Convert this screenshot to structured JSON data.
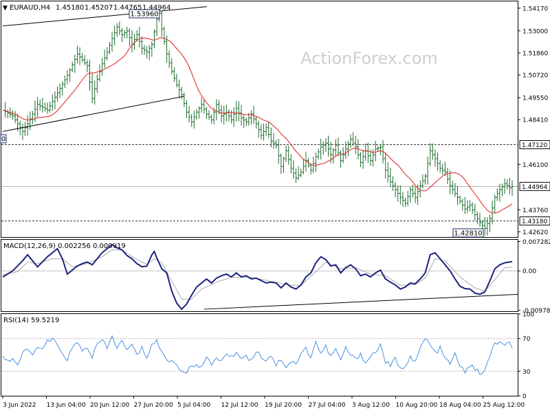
{
  "chart_data": [
    {
      "type": "candlestick",
      "title": "EURAUD,H4",
      "ohlc_label": {
        "open": "1.45180",
        "high": "1.45207",
        "low": "1.44765",
        "close": "1.44964"
      },
      "watermark": "ActionForex.com",
      "ylim": [
        1.4235,
        1.5452
      ],
      "y_ticks": [
        "1.54170",
        "1.53000",
        "1.51860",
        "1.50720",
        "1.49550",
        "1.48410",
        "1.47120",
        "1.46100",
        "1.44964",
        "1.43760",
        "1.43180",
        "1.42620"
      ],
      "x_ticks": [
        "3 Jun 2022",
        "13 Jun 04:00",
        "20 Jun 12:00",
        "27 Jun 20:00",
        "5 Jul 04:00",
        "12 Jul 12:00",
        "19 Jul 20:00",
        "27 Jul 04:00",
        "3 Aug 12:00",
        "10 Aug 20:00",
        "18 Aug 04:00",
        "25 Aug 12:00"
      ],
      "annotations": [
        "1.53960",
        "1.42810",
        "0"
      ],
      "horizontal_levels": [
        {
          "value": 1.4712,
          "label": "1.47120",
          "style": "dashed"
        },
        {
          "value": 1.4318,
          "label": "1.43180",
          "style": "dashed"
        },
        {
          "value": 1.44964,
          "label": "1.44964",
          "style": "solid-gray",
          "current_price": true
        }
      ],
      "moving_average_color": "#e03030",
      "price_color": "#1a6b2a",
      "close_path": [
        [
          0,
          1.489
        ],
        [
          4,
          1.486
        ],
        [
          8,
          1.478
        ],
        [
          10,
          1.482
        ],
        [
          14,
          1.492
        ],
        [
          18,
          1.489
        ],
        [
          22,
          1.498
        ],
        [
          26,
          1.507
        ],
        [
          30,
          1.518
        ],
        [
          34,
          1.512
        ],
        [
          36,
          1.495
        ],
        [
          38,
          1.505
        ],
        [
          40,
          1.513
        ],
        [
          42,
          1.519
        ],
        [
          44,
          1.526
        ],
        [
          46,
          1.532
        ],
        [
          48,
          1.528
        ],
        [
          50,
          1.53
        ],
        [
          52,
          1.523
        ],
        [
          54,
          1.528
        ],
        [
          56,
          1.521
        ],
        [
          58,
          1.519
        ],
        [
          60,
          1.523
        ],
        [
          62,
          1.536
        ],
        [
          63,
          1.539
        ],
        [
          64,
          1.531
        ],
        [
          66,
          1.518
        ],
        [
          68,
          1.509
        ],
        [
          70,
          1.502
        ],
        [
          72,
          1.497
        ],
        [
          74,
          1.488
        ],
        [
          76,
          1.483
        ],
        [
          78,
          1.488
        ],
        [
          80,
          1.492
        ],
        [
          82,
          1.487
        ],
        [
          84,
          1.484
        ],
        [
          86,
          1.492
        ],
        [
          88,
          1.486
        ],
        [
          90,
          1.488
        ],
        [
          92,
          1.484
        ],
        [
          94,
          1.49
        ],
        [
          96,
          1.485
        ],
        [
          98,
          1.483
        ],
        [
          100,
          1.487
        ],
        [
          102,
          1.482
        ],
        [
          104,
          1.476
        ],
        [
          106,
          1.48
        ],
        [
          108,
          1.473
        ],
        [
          110,
          1.471
        ],
        [
          112,
          1.46
        ],
        [
          114,
          1.468
        ],
        [
          116,
          1.459
        ],
        [
          118,
          1.454
        ],
        [
          120,
          1.457
        ],
        [
          122,
          1.463
        ],
        [
          124,
          1.458
        ],
        [
          126,
          1.465
        ],
        [
          128,
          1.47
        ],
        [
          130,
          1.472
        ],
        [
          132,
          1.466
        ],
        [
          134,
          1.471
        ],
        [
          136,
          1.463
        ],
        [
          138,
          1.469
        ],
        [
          140,
          1.474
        ],
        [
          142,
          1.47
        ],
        [
          144,
          1.462
        ],
        [
          146,
          1.468
        ],
        [
          148,
          1.463
        ],
        [
          150,
          1.469
        ],
        [
          152,
          1.47
        ],
        [
          154,
          1.458
        ],
        [
          156,
          1.452
        ],
        [
          158,
          1.448
        ],
        [
          160,
          1.444
        ],
        [
          162,
          1.441
        ],
        [
          164,
          1.448
        ],
        [
          166,
          1.444
        ],
        [
          168,
          1.45
        ],
        [
          170,
          1.455
        ],
        [
          172,
          1.468
        ],
        [
          174,
          1.464
        ],
        [
          176,
          1.459
        ],
        [
          178,
          1.457
        ],
        [
          180,
          1.45
        ],
        [
          182,
          1.446
        ],
        [
          184,
          1.442
        ],
        [
          186,
          1.438
        ],
        [
          188,
          1.44
        ],
        [
          190,
          1.435
        ],
        [
          192,
          1.431
        ],
        [
          194,
          1.428
        ],
        [
          196,
          1.433
        ],
        [
          198,
          1.444
        ],
        [
          200,
          1.448
        ],
        [
          202,
          1.451
        ],
        [
          204,
          1.449
        ],
        [
          205,
          1.4496
        ]
      ]
    },
    {
      "type": "line",
      "title": "MACD(12,26,9) 0.002256 0.000919",
      "ylim": [
        -0.01,
        0.0077
      ],
      "y_ticks": [
        "0.007282",
        "0.00",
        "-0.009787"
      ],
      "series": [
        {
          "name": "MACD",
          "color": "#1a237e"
        },
        {
          "name": "signal",
          "color": "#aaaaaa"
        }
      ],
      "macd_path": [
        [
          0,
          -0.0015
        ],
        [
          4,
          0.0
        ],
        [
          8,
          0.0025
        ],
        [
          10,
          0.004
        ],
        [
          14,
          0.001
        ],
        [
          18,
          0.0035
        ],
        [
          22,
          0.0055
        ],
        [
          24,
          0.003
        ],
        [
          26,
          -0.0008
        ],
        [
          28,
          0.0002
        ],
        [
          30,
          0.0012
        ],
        [
          32,
          0.0018
        ],
        [
          34,
          0.0022
        ],
        [
          36,
          0.0015
        ],
        [
          38,
          0.003
        ],
        [
          40,
          0.0045
        ],
        [
          42,
          0.0055
        ],
        [
          44,
          0.0065
        ],
        [
          46,
          0.0057
        ],
        [
          48,
          0.0052
        ],
        [
          50,
          0.0038
        ],
        [
          52,
          0.003
        ],
        [
          54,
          0.0018
        ],
        [
          56,
          0.001
        ],
        [
          58,
          0.0012
        ],
        [
          60,
          0.004
        ],
        [
          61,
          0.0048
        ],
        [
          62,
          0.0032
        ],
        [
          64,
          0.0005
        ],
        [
          66,
          -0.0005
        ],
        [
          68,
          -0.005
        ],
        [
          70,
          -0.008
        ],
        [
          72,
          -0.0095
        ],
        [
          74,
          -0.0082
        ],
        [
          76,
          -0.006
        ],
        [
          78,
          -0.004
        ],
        [
          80,
          -0.003
        ],
        [
          82,
          -0.002
        ],
        [
          84,
          -0.003
        ],
        [
          86,
          -0.0018
        ],
        [
          88,
          -0.0012
        ],
        [
          90,
          -0.0008
        ],
        [
          92,
          -0.0015
        ],
        [
          94,
          -0.0005
        ],
        [
          96,
          -0.0015
        ],
        [
          98,
          -0.0012
        ],
        [
          100,
          -0.002
        ],
        [
          102,
          -0.0018
        ],
        [
          104,
          -0.0024
        ],
        [
          106,
          -0.003
        ],
        [
          108,
          -0.0028
        ],
        [
          110,
          -0.003
        ],
        [
          112,
          -0.0042
        ],
        [
          114,
          -0.003
        ],
        [
          116,
          -0.004
        ],
        [
          118,
          -0.0045
        ],
        [
          120,
          -0.0035
        ],
        [
          122,
          -0.0015
        ],
        [
          124,
          -0.0005
        ],
        [
          126,
          0.002
        ],
        [
          128,
          0.0035
        ],
        [
          130,
          0.0028
        ],
        [
          132,
          0.0012
        ],
        [
          134,
          0.0015
        ],
        [
          136,
          -0.0005
        ],
        [
          138,
          0.0008
        ],
        [
          140,
          0.0015
        ],
        [
          142,
          0.0005
        ],
        [
          144,
          -0.0012
        ],
        [
          146,
          -0.0008
        ],
        [
          148,
          -0.0015
        ],
        [
          150,
          -0.0005
        ],
        [
          152,
          0.0002
        ],
        [
          154,
          -0.002
        ],
        [
          156,
          -0.0028
        ],
        [
          158,
          -0.0035
        ],
        [
          160,
          -0.0045
        ],
        [
          162,
          -0.004
        ],
        [
          164,
          -0.003
        ],
        [
          166,
          -0.0032
        ],
        [
          168,
          -0.002
        ],
        [
          170,
          -0.0005
        ],
        [
          172,
          0.004
        ],
        [
          174,
          0.0045
        ],
        [
          176,
          0.003
        ],
        [
          178,
          0.0015
        ],
        [
          180,
          0.0
        ],
        [
          182,
          -0.002
        ],
        [
          184,
          -0.0038
        ],
        [
          186,
          -0.0044
        ],
        [
          188,
          -0.0045
        ],
        [
          190,
          -0.0055
        ],
        [
          192,
          -0.0058
        ],
        [
          194,
          -0.0052
        ],
        [
          196,
          -0.0025
        ],
        [
          198,
          0.0005
        ],
        [
          200,
          0.0015
        ],
        [
          202,
          0.002
        ],
        [
          205,
          0.0023
        ]
      ],
      "signal_path": [
        [
          0,
          -0.001
        ],
        [
          6,
          -0.0002
        ],
        [
          10,
          0.0022
        ],
        [
          14,
          0.0018
        ],
        [
          20,
          0.003
        ],
        [
          24,
          0.003
        ],
        [
          28,
          0.001
        ],
        [
          34,
          0.0018
        ],
        [
          40,
          0.0035
        ],
        [
          44,
          0.0052
        ],
        [
          48,
          0.0052
        ],
        [
          54,
          0.0028
        ],
        [
          58,
          0.0016
        ],
        [
          61,
          0.003
        ],
        [
          64,
          0.002
        ],
        [
          68,
          -0.0025
        ],
        [
          72,
          -0.007
        ],
        [
          76,
          -0.007
        ],
        [
          80,
          -0.0045
        ],
        [
          86,
          -0.0028
        ],
        [
          92,
          -0.0016
        ],
        [
          100,
          -0.0016
        ],
        [
          108,
          -0.0026
        ],
        [
          116,
          -0.0036
        ],
        [
          120,
          -0.0036
        ],
        [
          126,
          -0.0002
        ],
        [
          130,
          0.0022
        ],
        [
          136,
          0.0005
        ],
        [
          142,
          0.0008
        ],
        [
          148,
          -0.0008
        ],
        [
          154,
          -0.0012
        ],
        [
          160,
          -0.0036
        ],
        [
          166,
          -0.0034
        ],
        [
          170,
          -0.0018
        ],
        [
          174,
          0.003
        ],
        [
          178,
          0.0025
        ],
        [
          184,
          -0.0015
        ],
        [
          190,
          -0.0042
        ],
        [
          194,
          -0.005
        ],
        [
          198,
          -0.0022
        ],
        [
          202,
          0.0008
        ],
        [
          205,
          0.0009
        ]
      ]
    },
    {
      "type": "line",
      "title": "RSI(14) 59.5219",
      "ylim": [
        0,
        100
      ],
      "y_ticks": [
        "100",
        "70",
        "30",
        "0"
      ],
      "levels": [
        70,
        30
      ],
      "series": [
        {
          "name": "RSI",
          "color": "#4a90e2"
        }
      ],
      "rsi_path": [
        [
          0,
          50
        ],
        [
          2,
          42
        ],
        [
          4,
          46
        ],
        [
          6,
          38
        ],
        [
          8,
          50
        ],
        [
          10,
          58
        ],
        [
          12,
          48
        ],
        [
          14,
          62
        ],
        [
          16,
          55
        ],
        [
          18,
          66
        ],
        [
          20,
          70
        ],
        [
          22,
          60
        ],
        [
          24,
          52
        ],
        [
          26,
          45
        ],
        [
          28,
          58
        ],
        [
          30,
          65
        ],
        [
          32,
          54
        ],
        [
          34,
          60
        ],
        [
          36,
          48
        ],
        [
          38,
          62
        ],
        [
          40,
          68
        ],
        [
          42,
          58
        ],
        [
          44,
          72
        ],
        [
          46,
          60
        ],
        [
          48,
          66
        ],
        [
          50,
          56
        ],
        [
          52,
          62
        ],
        [
          54,
          50
        ],
        [
          56,
          58
        ],
        [
          58,
          48
        ],
        [
          60,
          62
        ],
        [
          62,
          68
        ],
        [
          64,
          52
        ],
        [
          66,
          45
        ],
        [
          68,
          42
        ],
        [
          70,
          38
        ],
        [
          72,
          32
        ],
        [
          74,
          28
        ],
        [
          76,
          36
        ],
        [
          78,
          40
        ],
        [
          80,
          35
        ],
        [
          82,
          45
        ],
        [
          84,
          38
        ],
        [
          86,
          48
        ],
        [
          88,
          42
        ],
        [
          90,
          52
        ],
        [
          92,
          46
        ],
        [
          94,
          55
        ],
        [
          96,
          45
        ],
        [
          98,
          50
        ],
        [
          100,
          42
        ],
        [
          102,
          56
        ],
        [
          104,
          48
        ],
        [
          106,
          44
        ],
        [
          108,
          50
        ],
        [
          110,
          38
        ],
        [
          112,
          45
        ],
        [
          114,
          36
        ],
        [
          116,
          42
        ],
        [
          118,
          40
        ],
        [
          120,
          50
        ],
        [
          122,
          58
        ],
        [
          124,
          48
        ],
        [
          126,
          66
        ],
        [
          128,
          52
        ],
        [
          130,
          60
        ],
        [
          132,
          48
        ],
        [
          134,
          56
        ],
        [
          136,
          44
        ],
        [
          138,
          58
        ],
        [
          140,
          50
        ],
        [
          142,
          44
        ],
        [
          144,
          52
        ],
        [
          146,
          40
        ],
        [
          148,
          48
        ],
        [
          150,
          54
        ],
        [
          152,
          62
        ],
        [
          154,
          42
        ],
        [
          156,
          36
        ],
        [
          158,
          45
        ],
        [
          160,
          32
        ],
        [
          162,
          38
        ],
        [
          164,
          48
        ],
        [
          166,
          40
        ],
        [
          168,
          58
        ],
        [
          170,
          70
        ],
        [
          172,
          62
        ],
        [
          174,
          52
        ],
        [
          176,
          58
        ],
        [
          178,
          45
        ],
        [
          180,
          40
        ],
        [
          182,
          50
        ],
        [
          184,
          36
        ],
        [
          186,
          30
        ],
        [
          188,
          38
        ],
        [
          190,
          32
        ],
        [
          192,
          28
        ],
        [
          194,
          30
        ],
        [
          196,
          48
        ],
        [
          198,
          64
        ],
        [
          200,
          66
        ],
        [
          202,
          60
        ],
        [
          204,
          64
        ],
        [
          205,
          60
        ]
      ]
    }
  ]
}
